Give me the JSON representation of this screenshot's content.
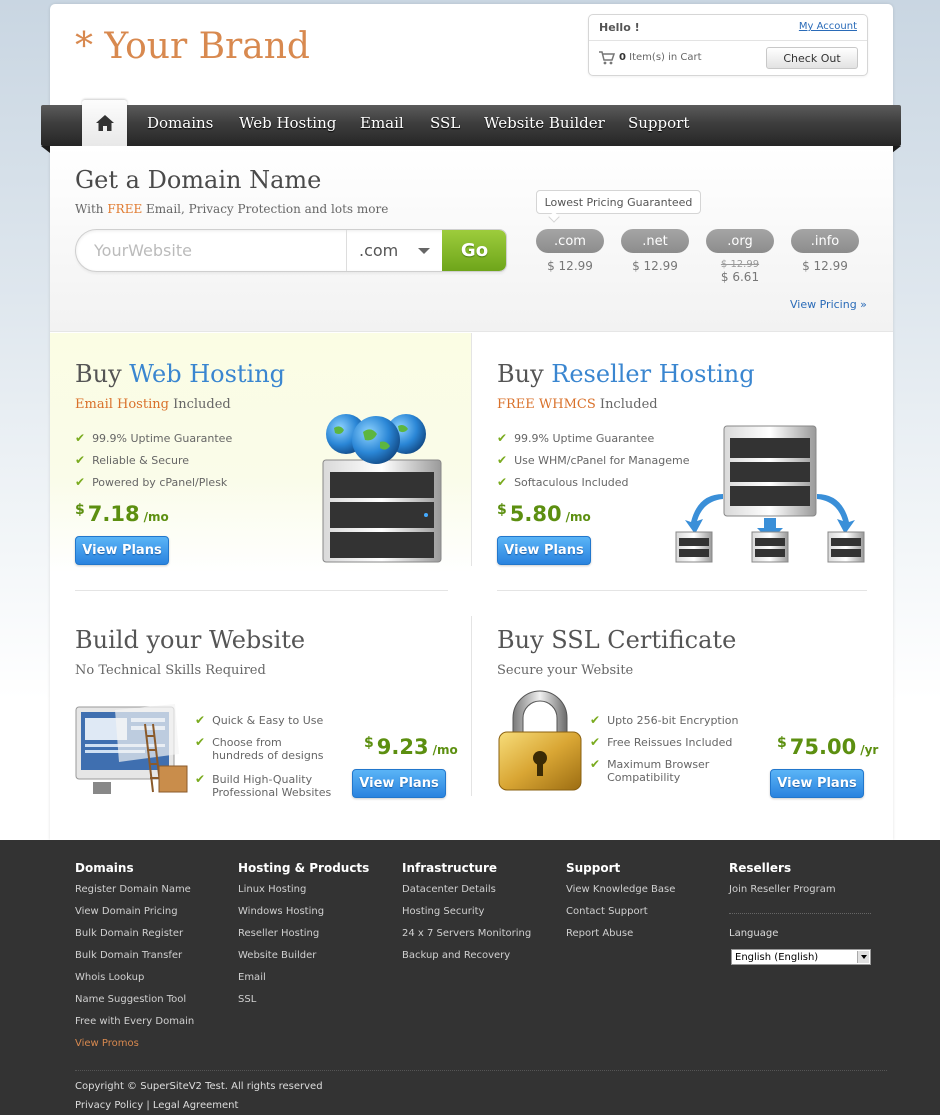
{
  "brand": "* Your Brand",
  "account": {
    "hello": "Hello !",
    "my_account": "My Account",
    "cart_count": "0",
    "cart_text": "Item(s) in Cart",
    "checkout": "Check Out"
  },
  "nav": {
    "items": [
      "Domains",
      "Web Hosting",
      "Email",
      "SSL",
      "Website Builder",
      "Support"
    ]
  },
  "domain": {
    "title": "Get a Domain Name",
    "subtitle_pre": "With ",
    "subtitle_hl": "FREE",
    "subtitle_post": " Email, Privacy Protection and lots more",
    "placeholder": "YourWebsite",
    "tld_selected": ".com",
    "go": "Go",
    "lowest_pricing": "Lowest Pricing Guaranteed",
    "tlds": [
      {
        "name": ".com",
        "price": "$ 12.99"
      },
      {
        "name": ".net",
        "price": "$ 12.99"
      },
      {
        "name": ".org",
        "old_price": "$ 12.99",
        "price": "$ 6.61"
      },
      {
        "name": ".info",
        "price": "$ 12.99"
      }
    ],
    "view_pricing": "View Pricing »"
  },
  "web_hosting": {
    "title_pre": "Buy ",
    "title_hl": "Web Hosting",
    "sub_hl": "Email Hosting",
    "sub_post": " Included",
    "features": [
      "99.9% Uptime Guarantee",
      "Reliable & Secure",
      "Powered by cPanel/Plesk"
    ],
    "currency": "$",
    "price": "7.18",
    "period": "/mo",
    "button": "View Plans"
  },
  "reseller_hosting": {
    "title_pre": "Buy ",
    "title_hl": "Reseller Hosting",
    "sub_hl": "FREE WHMCS",
    "sub_post": " Included",
    "features": [
      "99.9% Uptime Guarantee",
      "Use WHM/cPanel for Manageme",
      "Softaculous Included"
    ],
    "currency": "$",
    "price": "5.80",
    "period": "/mo",
    "button": "View Plans"
  },
  "website_builder": {
    "title": "Build your Website",
    "subtitle": "No Technical Skills Required",
    "features": [
      "Quick & Easy to Use",
      "Choose from hundreds of designs",
      "Build High-Quality Professional Websites"
    ],
    "currency": "$",
    "price": "9.23",
    "period": "/mo",
    "button": "View Plans"
  },
  "ssl": {
    "title": "Buy SSL Certificate",
    "subtitle": "Secure your Website",
    "features": [
      "Upto 256-bit Encryption",
      "Free Reissues Included",
      "Maximum Browser Compatibility"
    ],
    "currency": "$",
    "price": "75.00",
    "period": "/yr",
    "button": "View Plans"
  },
  "footer": {
    "columns": [
      {
        "heading": "Domains",
        "links": [
          "Register Domain Name",
          "View Domain Pricing",
          "Bulk Domain Register",
          "Bulk Domain Transfer",
          "Whois Lookup",
          "Name Suggestion Tool",
          "Free with Every Domain",
          "View Promos"
        ]
      },
      {
        "heading": "Hosting & Products",
        "links": [
          "Linux Hosting",
          "Windows Hosting",
          "Reseller Hosting",
          "Website Builder",
          "Email",
          "SSL"
        ]
      },
      {
        "heading": "Infrastructure",
        "links": [
          "Datacenter Details",
          "Hosting Security",
          "24 x 7 Servers Monitoring",
          "Backup and Recovery"
        ]
      },
      {
        "heading": "Support",
        "links": [
          "View Knowledge Base",
          "Contact Support",
          "Report Abuse"
        ]
      },
      {
        "heading": "Resellers",
        "links": [
          "Join Reseller Program"
        ]
      }
    ],
    "language_label": "Language",
    "language_selected": "English (English)",
    "copyright": "Copyright © SuperSiteV2 Test. All rights reserved",
    "privacy": "Privacy Policy",
    "legal": "Legal Agreement"
  },
  "colors": {
    "brand": "#d8894f",
    "accent_blue": "#3a86d0",
    "price_green": "#5c8f10",
    "go_green": "#7fb229",
    "footer_bg": "#333333"
  }
}
